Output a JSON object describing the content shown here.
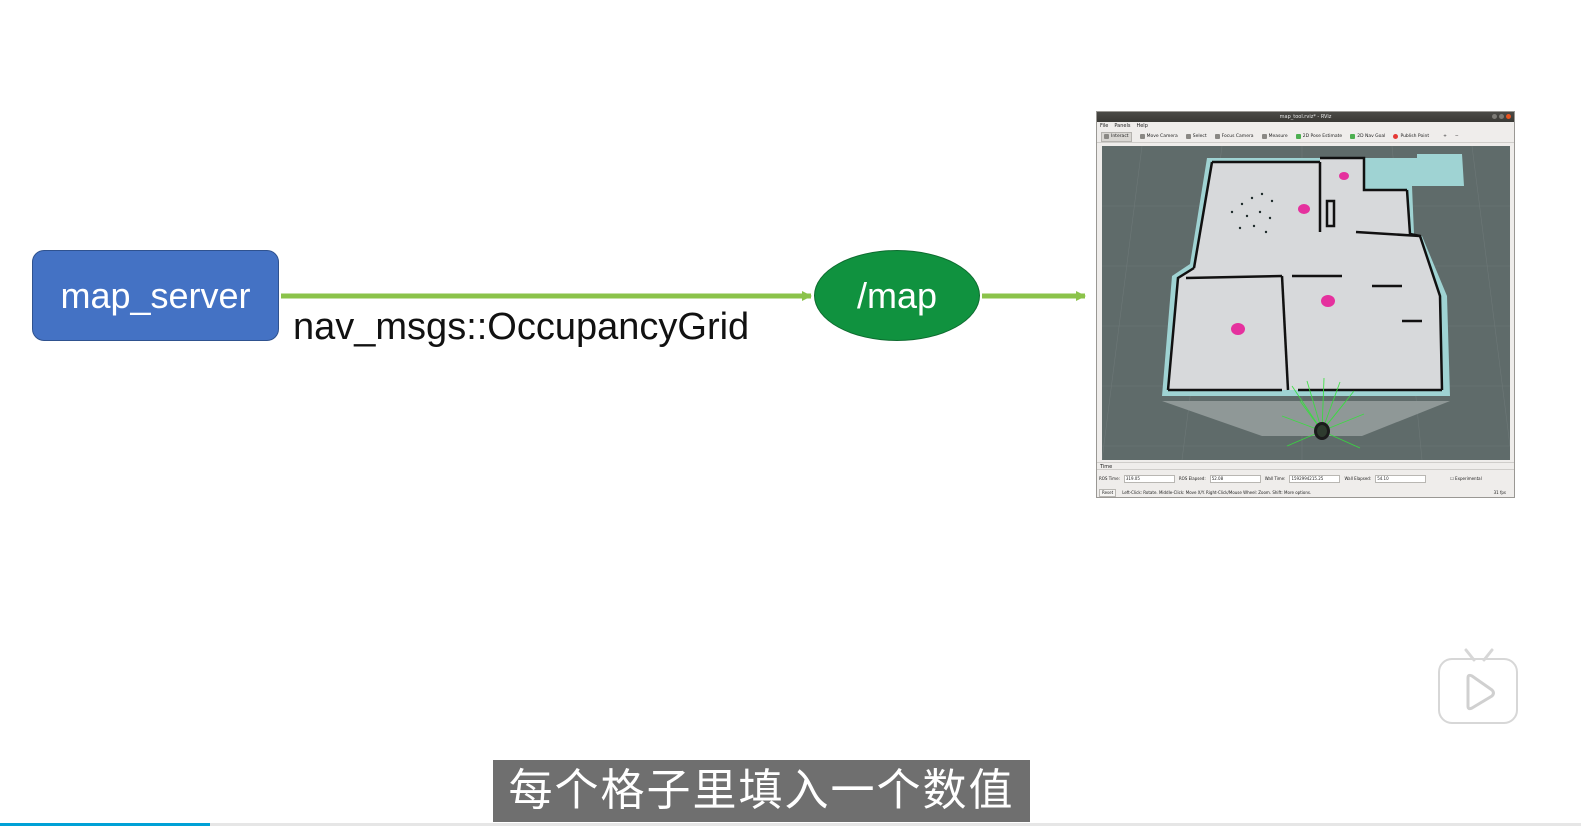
{
  "diagram": {
    "source_node": "map_server",
    "topic_node": "/map",
    "message_type": "nav_msgs::OccupancyGrid",
    "arrow_color": "#8bc34a",
    "source_color": "#4472c4",
    "topic_color": "#10923f"
  },
  "rviz": {
    "window_title": "map_tool.rviz* - RViz",
    "menu": [
      "File",
      "Panels",
      "Help"
    ],
    "toolbar": [
      "Interact",
      "Move Camera",
      "Select",
      "Focus Camera",
      "Measure",
      "2D Pose Estimate",
      "2D Nav Goal",
      "Publish Point"
    ],
    "time_panel_title": "Time",
    "ros_time_label": "ROS Time:",
    "ros_time_value": "319.05",
    "ros_elapsed_label": "ROS Elapsed:",
    "ros_elapsed_value": "52.08",
    "wall_time_label": "Wall Time:",
    "wall_time_value": "1592994215.25",
    "wall_elapsed_label": "Wall Elapsed:",
    "wall_elapsed_value": "54.10",
    "experimental_label": "Experimental",
    "reset_label": "Reset",
    "status_text": "Left-Click: Rotate. Middle-Click: Move X/Y. Right-Click/Mouse Wheel: Zoom. Shift: More options.",
    "fps": "31 fps"
  },
  "subtitle": "每个格子里填入一个数值",
  "player": {
    "play_icon": "play-icon",
    "progress_fraction": 0.133
  }
}
